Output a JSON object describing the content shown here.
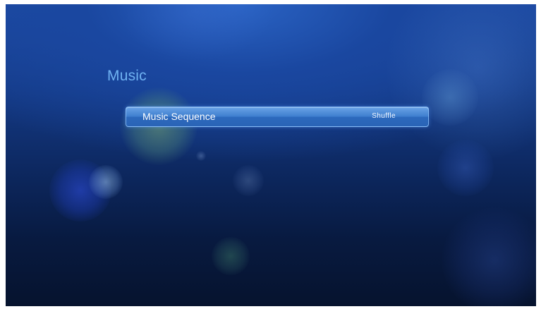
{
  "screen": {
    "title": "Music"
  },
  "menu": {
    "items": [
      {
        "label": "Music Sequence",
        "value": "Shuffle",
        "selected": true
      }
    ]
  },
  "colors": {
    "title": "#6fb2f2",
    "highlight": "#3f7fcf",
    "background_top": "#1d4aa3",
    "background_bottom": "#06132e"
  }
}
